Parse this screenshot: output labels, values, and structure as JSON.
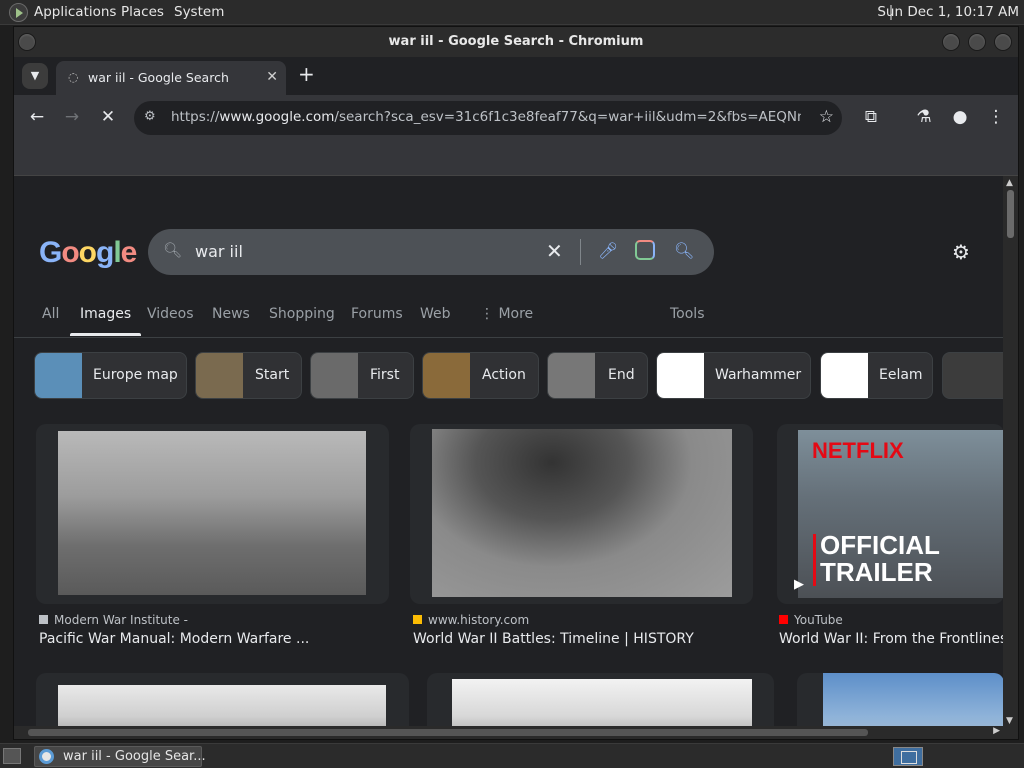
{
  "top_panel": {
    "menus": [
      "Applications",
      "Places",
      "System"
    ],
    "clock": "Sun Dec  1, 10:17 AM"
  },
  "window": {
    "title": "war iil - Google Search - Chromium"
  },
  "tab": {
    "title": "war iil - Google Search",
    "close": "✕",
    "new_tab": "+"
  },
  "toolbar": {
    "url_scheme": "https://",
    "url_host": "www.google.com",
    "url_path": "/search?sca_esv=31c6f1c3e8feaf77&q=war+iil&udm=2&fbs=AEQNm0Aa4..."
  },
  "google": {
    "logo_letters": [
      "G",
      "o",
      "o",
      "g",
      "l",
      "e"
    ],
    "query": "war iil",
    "tabs": [
      "All",
      "Images",
      "Videos",
      "News",
      "Shopping",
      "Forums",
      "Web",
      "More",
      "Tools"
    ],
    "more_prefix": "⋮",
    "chips": [
      {
        "label": "Europe map",
        "thumb_color": "#5b8fb8"
      },
      {
        "label": "Start",
        "thumb_color": "#7a6a4f"
      },
      {
        "label": "First",
        "thumb_color": "#6a6a6a"
      },
      {
        "label": "Action",
        "thumb_color": "#8a6a3a"
      },
      {
        "label": "End",
        "thumb_color": "#777777"
      },
      {
        "label": "Warhammer",
        "thumb_color": "#ffffff"
      },
      {
        "label": "Eelam",
        "thumb_color": "#ffffff"
      }
    ],
    "results": [
      {
        "source": "Modern War Institute -",
        "title": "Pacific War Manual: Modern Warfare ...",
        "fav_color": "#bdc1c6"
      },
      {
        "source": "www.history.com",
        "title": "World War II Battles: Timeline | HISTORY",
        "fav_color": "#fbbc04"
      },
      {
        "source": "YouTube",
        "title": "World War II: From the Frontlines ...",
        "fav_color": "#ff0000"
      }
    ],
    "trailer": {
      "brand": "NETFLIX",
      "line1": "OFFICIAL",
      "line2": "TRAILER"
    }
  },
  "taskbar": {
    "task_label": "war iil - Google Sear..."
  }
}
